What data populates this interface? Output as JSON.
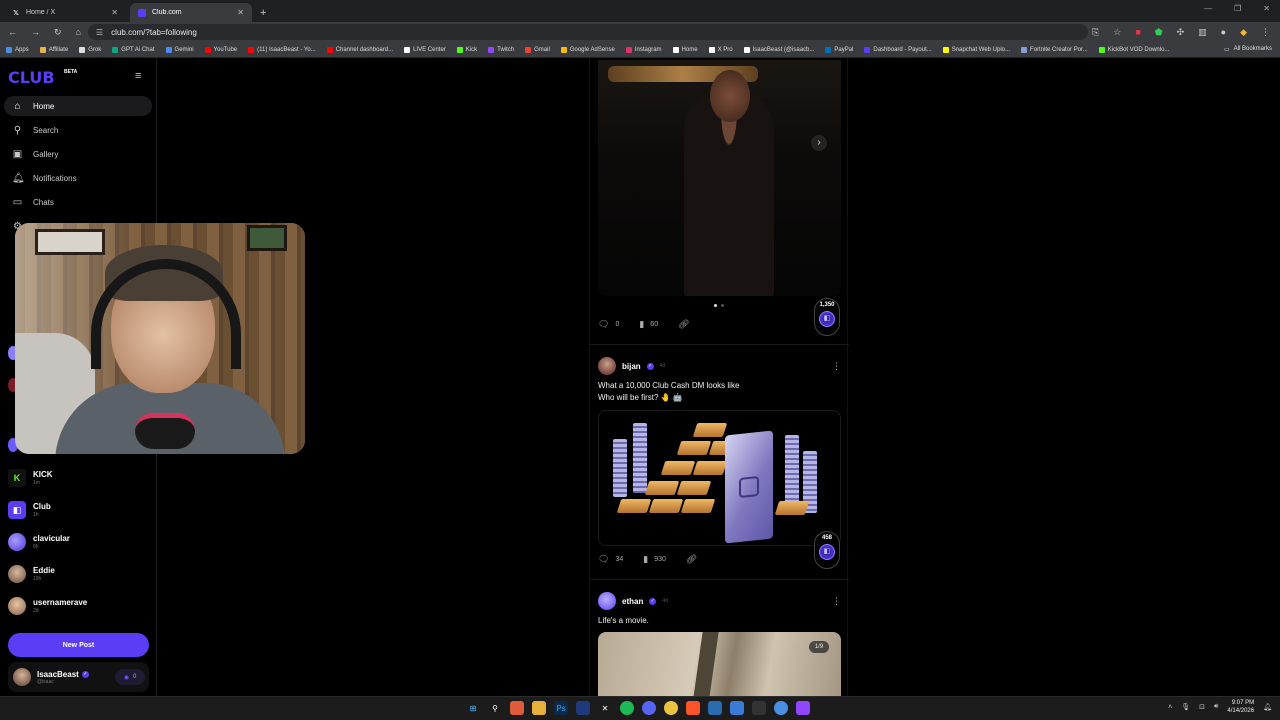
{
  "browser": {
    "tabs": [
      {
        "title": "Home / X",
        "icon": "x-logo-icon",
        "active": false
      },
      {
        "title": "Club.com",
        "icon": "club-logo-icon",
        "active": true
      }
    ],
    "url": "club.com/?tab=following",
    "bookmarks": [
      {
        "label": "Apps",
        "color": "#4a90e2"
      },
      {
        "label": "Affiliate",
        "color": "#e6b44a"
      },
      {
        "label": "Grok",
        "color": "#dddddd"
      },
      {
        "label": "GPT Ai Chat",
        "color": "#10a37f"
      },
      {
        "label": "Gemini",
        "color": "#4a8cf7"
      },
      {
        "label": "YouTube",
        "color": "#ff0000"
      },
      {
        "label": "(11) IsaacBeast - Yo...",
        "color": "#ff0000"
      },
      {
        "label": "Channel dashboard...",
        "color": "#ff0000"
      },
      {
        "label": "LIVE Center",
        "color": "#ffffff"
      },
      {
        "label": "Kick",
        "color": "#53fc18"
      },
      {
        "label": "Twitch",
        "color": "#9146ff"
      },
      {
        "label": "Gmail",
        "color": "#ea4335"
      },
      {
        "label": "Google AdSense",
        "color": "#fbbc05"
      },
      {
        "label": "Instagram",
        "color": "#e1306c"
      },
      {
        "label": "Home",
        "color": "#ffffff"
      },
      {
        "label": "X Pro",
        "color": "#ffffff"
      },
      {
        "label": "IsaacBeast (@isaacb...",
        "color": "#ffffff"
      },
      {
        "label": "PayPal",
        "color": "#0070ba"
      },
      {
        "label": "Dashboard - Payout...",
        "color": "#5b3df5"
      },
      {
        "label": "Snapchat Web Uplo...",
        "color": "#fffc00"
      },
      {
        "label": "Fortnite Creator Por...",
        "color": "#8a9ad8"
      },
      {
        "label": "KickBot VOD Downlo...",
        "color": "#53fc18"
      }
    ],
    "all_bookmarks": "All Bookmarks"
  },
  "sidebar": {
    "logo": "CLUB",
    "beta": "BETA",
    "nav": [
      {
        "label": "Home",
        "icon": "home-icon",
        "glyph": "⌂",
        "active": true
      },
      {
        "label": "Search",
        "icon": "search-icon",
        "glyph": "⚲",
        "active": false
      },
      {
        "label": "Gallery",
        "icon": "gallery-icon",
        "glyph": "▣",
        "active": false
      },
      {
        "label": "Notifications",
        "icon": "bell-icon",
        "glyph": "♫",
        "active": false
      },
      {
        "label": "Chats",
        "icon": "chat-icon",
        "glyph": "▭",
        "active": false
      }
    ],
    "users": [
      {
        "name": "KICK",
        "time": "1m",
        "avatar": "kick",
        "glyph": "K"
      },
      {
        "name": "Club",
        "time": "1h",
        "avatar": "club",
        "glyph": "◧"
      },
      {
        "name": "clavicular",
        "time": "6h",
        "avatar": "purple",
        "glyph": ""
      },
      {
        "name": "Eddie",
        "time": "19h",
        "avatar": "face",
        "glyph": ""
      },
      {
        "name": "usernamerave",
        "time": "2d",
        "avatar": "face2",
        "glyph": ""
      }
    ],
    "new_post": "New Post",
    "me": {
      "name": "IsaacBeast",
      "handle": "@isaac",
      "balance": "0"
    }
  },
  "feed": {
    "post1": {
      "comments": "0",
      "views": "60",
      "coins": "1,350"
    },
    "post2": {
      "user": "bijan",
      "time": "4d",
      "text_line1": "What a 10,000 Club Cash DM looks like",
      "text_line2": "Who will be first? 🤚 🤖",
      "comments": "34",
      "views": "930",
      "coins": "458"
    },
    "post3": {
      "user": "ethan",
      "time": "4d",
      "text": "Life's a movie.",
      "pager": "1/9"
    }
  },
  "taskbar": {
    "time": "9:07 PM",
    "date": "4/14/2026"
  }
}
